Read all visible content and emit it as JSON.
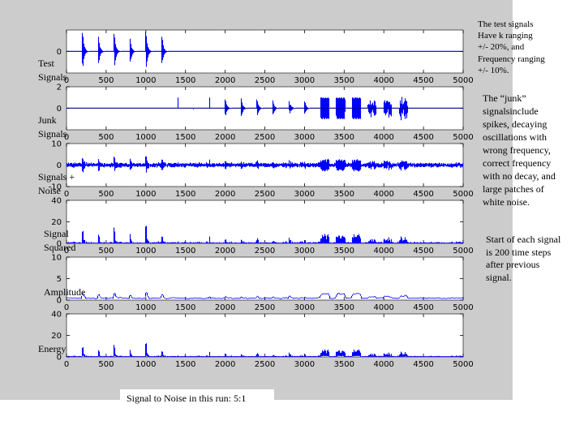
{
  "slide": {
    "notes": {
      "test_signals": [
        "The test signals",
        "Have k ranging",
        "+/- 20%, and",
        "Frequency ranging",
        "+/- 10%."
      ],
      "junk_signals": [
        "The “junk”",
        "signalsinclude",
        "spikes, decaying",
        "oscillations with",
        "wrong frequency,",
        "correct frequency",
        "with no decay, and",
        "large patches of",
        "white noise."
      ],
      "start_spacing": [
        "Start of each signal",
        "is 200 time steps",
        "after previous",
        "signal."
      ]
    },
    "snr_label": "Signal to Noise in this run:  5:1"
  },
  "chart_data": [
    {
      "type": "line",
      "panel": "test-signals",
      "ylabel": [
        "Test",
        "Signals"
      ],
      "xlim": [
        0,
        5000
      ],
      "ylim": [
        -2,
        2
      ],
      "xticks": [
        "0",
        "500",
        "1000",
        "1500",
        "2000",
        "2500",
        "3000",
        "3500",
        "4000",
        "4500",
        "5000"
      ],
      "yticks": [
        {
          "value": 0,
          "label": "0"
        }
      ],
      "color": "#0000ff",
      "events": [
        {
          "start": 200,
          "kind": "decay",
          "amp": 1.9
        },
        {
          "start": 400,
          "kind": "decay",
          "amp": 1.5
        },
        {
          "start": 600,
          "kind": "decay",
          "amp": 1.8
        },
        {
          "start": 800,
          "kind": "decay",
          "amp": 1.3
        },
        {
          "start": 1000,
          "kind": "decay",
          "amp": 2.0
        },
        {
          "start": 1200,
          "kind": "decay",
          "amp": 1.5
        }
      ]
    },
    {
      "type": "line",
      "panel": "junk-signals",
      "ylabel": [
        "Junk",
        "Signals"
      ],
      "xlim": [
        0,
        5000
      ],
      "ylim": [
        -2,
        2
      ],
      "xticks": [
        "0",
        "500",
        "1000",
        "1500",
        "2000",
        "2500",
        "3000",
        "3500",
        "4000",
        "4500",
        "5000"
      ],
      "yticks": [
        {
          "value": 0,
          "label": "0"
        },
        {
          "value": 2,
          "label": "2"
        }
      ],
      "color": "#0000ff",
      "events": [
        {
          "start": 1400,
          "kind": "spike",
          "amp": 1.0
        },
        {
          "start": 1600,
          "kind": "spike",
          "amp": -0.1
        },
        {
          "start": 1800,
          "kind": "spike",
          "amp": 1.0
        },
        {
          "start": 2000,
          "kind": "decay",
          "amp": 0.9
        },
        {
          "start": 2200,
          "kind": "decay",
          "amp": 1.0
        },
        {
          "start": 2400,
          "kind": "decay",
          "amp": 0.9
        },
        {
          "start": 2600,
          "kind": "decay",
          "amp": 0.8
        },
        {
          "start": 2800,
          "kind": "wrongfreq",
          "amp": 0.8
        },
        {
          "start": 3000,
          "kind": "decay",
          "amp": 0.7
        },
        {
          "start": 3200,
          "kind": "block",
          "amp": 1.0
        },
        {
          "start": 3400,
          "kind": "block",
          "amp": 1.0
        },
        {
          "start": 3600,
          "kind": "block",
          "amp": 1.0
        },
        {
          "start": 3800,
          "kind": "noise",
          "amp": 1.1
        },
        {
          "start": 4000,
          "kind": "noise",
          "amp": 1.2
        },
        {
          "start": 4200,
          "kind": "noise",
          "amp": 1.5
        }
      ]
    },
    {
      "type": "line",
      "panel": "signals-plus-noise",
      "ylabel": [
        "Signals +",
        "Noise"
      ],
      "xlim": [
        0,
        5000
      ],
      "ylim": [
        -10,
        10
      ],
      "xticks": [
        "0",
        "500",
        "1000",
        "1500",
        "2000",
        "2500",
        "3000",
        "3500",
        "4000",
        "4500",
        "5000"
      ],
      "yticks": [
        {
          "value": 0,
          "label": "0"
        },
        {
          "value": 10,
          "label": "10"
        },
        {
          "value": -10,
          "label": "-10"
        }
      ],
      "color": "#0000ff"
    },
    {
      "type": "line",
      "panel": "signal-squared",
      "ylabel": [
        "Signal",
        "Squared"
      ],
      "xlim": [
        0,
        5000
      ],
      "ylim": [
        0,
        40
      ],
      "xticks": [
        "0",
        "500",
        "1000",
        "1500",
        "2000",
        "2500",
        "3000",
        "3500",
        "4000",
        "4500",
        "5000"
      ],
      "yticks": [
        {
          "value": 0,
          "label": "0"
        },
        {
          "value": 20,
          "label": "20"
        },
        {
          "value": 40,
          "label": "40"
        }
      ],
      "color": "#0000ff"
    },
    {
      "type": "line",
      "panel": "amplitude",
      "ylabel": [
        "Amplitude"
      ],
      "xlim": [
        0,
        5000
      ],
      "ylim": [
        0,
        10
      ],
      "xticks": [
        "0",
        "500",
        "1000",
        "1500",
        "2000",
        "2500",
        "3000",
        "3500",
        "4000",
        "4500",
        "5000"
      ],
      "yticks": [
        {
          "value": 0,
          "label": "0"
        },
        {
          "value": 5,
          "label": "5"
        },
        {
          "value": 10,
          "label": "10"
        }
      ],
      "color": "#0000ff"
    },
    {
      "type": "line",
      "panel": "energy",
      "ylabel": [
        "Energy"
      ],
      "xlim": [
        0,
        5000
      ],
      "ylim": [
        0,
        40
      ],
      "xticks": [
        "0",
        "500",
        "1000",
        "1500",
        "2000",
        "2500",
        "3000",
        "3500",
        "4000",
        "4500",
        "5000"
      ],
      "yticks": [
        {
          "value": 0,
          "label": "0"
        },
        {
          "value": 20,
          "label": "20"
        },
        {
          "value": 40,
          "label": "40"
        }
      ],
      "color": "#0000ff"
    }
  ]
}
